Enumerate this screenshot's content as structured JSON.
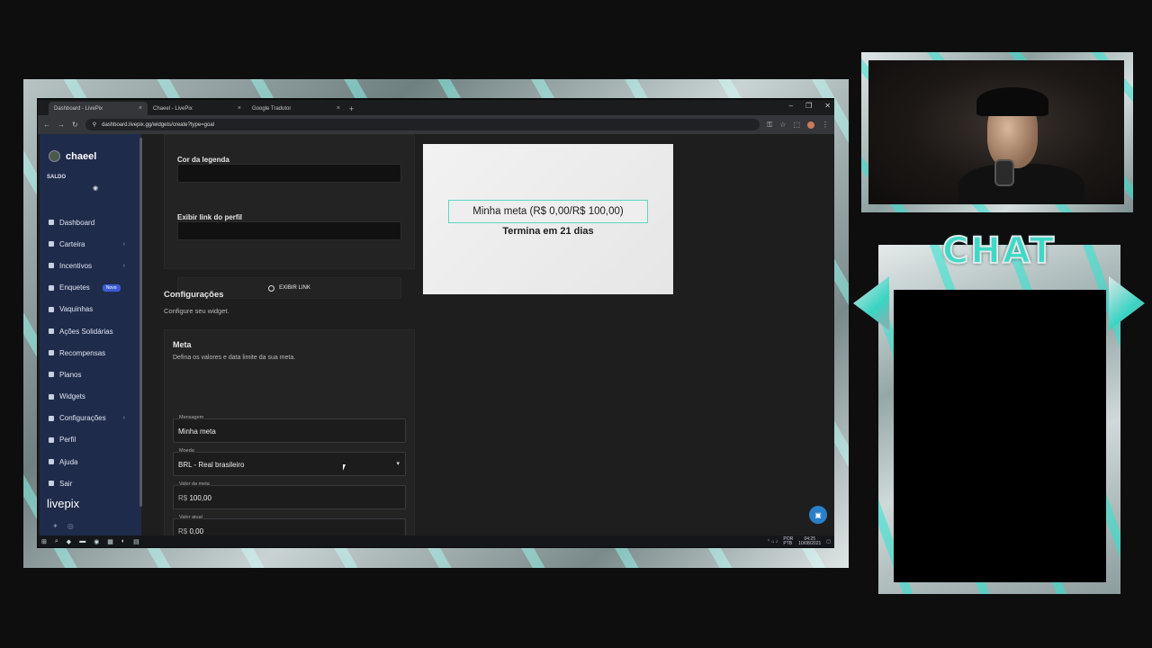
{
  "browser": {
    "tabs": [
      {
        "label": "Dashboard - LivePix",
        "active": true
      },
      {
        "label": "Chaeel - LivePix",
        "active": false
      },
      {
        "label": "Google Tradutor",
        "active": false
      }
    ],
    "url": "dashboard.livepix.gg/widgets/create?type=goal"
  },
  "sidebar": {
    "username": "chaeel",
    "saldo_label": "SALDO",
    "items": [
      {
        "label": "Dashboard",
        "chevron": false
      },
      {
        "label": "Carteira",
        "chevron": true
      },
      {
        "label": "Incentivos",
        "chevron": true
      },
      {
        "label": "Enquetes",
        "chevron": false,
        "badge": "Novo"
      },
      {
        "label": "Vaquinhas",
        "chevron": false
      },
      {
        "label": "Ações Solidárias",
        "chevron": false
      },
      {
        "label": "Recompensas",
        "chevron": false
      },
      {
        "label": "Planos",
        "chevron": false
      },
      {
        "label": "Widgets",
        "chevron": false
      },
      {
        "label": "Configurações",
        "chevron": true
      },
      {
        "label": "Perfil",
        "chevron": false
      },
      {
        "label": "Ajuda",
        "chevron": false
      },
      {
        "label": "Sair",
        "chevron": false
      }
    ],
    "logo": "livepix"
  },
  "form": {
    "legend_color_label": "Cor da legenda",
    "show_profile_link_label": "Exibir link do perfil",
    "show_link_radio": "EXIBIR LINK",
    "config_title": "Configurações",
    "config_subtitle": "Configure seu widget.",
    "meta_title": "Meta",
    "meta_subtitle": "Defina os valores e data limite da sua meta.",
    "message_label": "Mensagem",
    "message_value": "Minha meta",
    "currency_label": "Moeda",
    "currency_value": "BRL - Real brasileiro",
    "goal_value_label": "Valor da meta",
    "goal_value_prefix": "R$",
    "goal_value": "100,00",
    "current_value_label": "Valor atual",
    "current_value_prefix": "R$",
    "current_value": "0,00"
  },
  "preview": {
    "goal_text": "Minha meta (R$ 0,00/R$ 100,00)",
    "ends_text": "Termina em 21 dias"
  },
  "taskbar": {
    "lang": "POR",
    "lang2": "PTB",
    "time": "04:25",
    "date": "10/08/2021"
  },
  "overlay": {
    "chat_title": "CHAT",
    "accent_color": "#3fd8c6"
  }
}
